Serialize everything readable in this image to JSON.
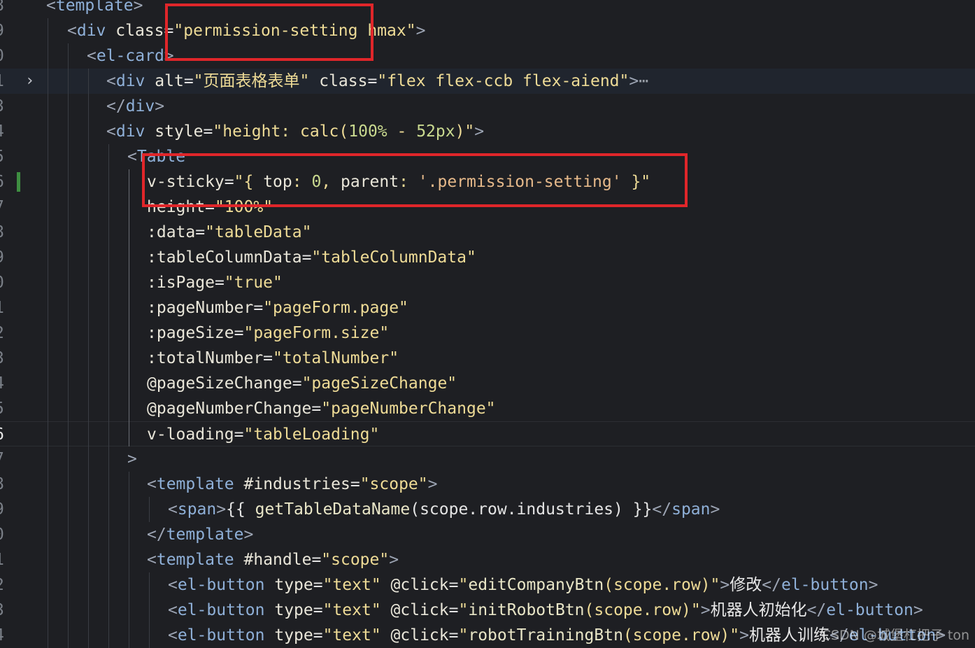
{
  "editor": {
    "watermark": "CSDN @城堡杠把子 ton",
    "lines": [
      {
        "num": "8",
        "tokens": [
          [
            "t-bracket",
            "<"
          ],
          [
            "t-tag",
            "template"
          ],
          [
            "t-bracket",
            ">"
          ]
        ]
      },
      {
        "num": "9",
        "tokens": [
          [
            "t-bracket",
            "<"
          ],
          [
            "t-tag",
            "div"
          ],
          [
            "t-plain",
            " "
          ],
          [
            "t-attr",
            "class"
          ],
          [
            "t-plain",
            "="
          ],
          [
            "t-str",
            "\"permission-setting hmax\""
          ],
          [
            "t-bracket",
            ">"
          ]
        ]
      },
      {
        "num": "0",
        "tokens": [
          [
            "t-bracket",
            "<"
          ],
          [
            "t-tag",
            "el-card"
          ],
          [
            "t-bracket",
            ">"
          ]
        ]
      },
      {
        "num": "1",
        "tokens": [
          [
            "t-bracket",
            "<"
          ],
          [
            "t-tag",
            "div"
          ],
          [
            "t-plain",
            " "
          ],
          [
            "t-attr",
            "alt"
          ],
          [
            "t-plain",
            "="
          ],
          [
            "t-str",
            "\"页面表格表单\""
          ],
          [
            "t-plain",
            " "
          ],
          [
            "t-attr",
            "class"
          ],
          [
            "t-plain",
            "="
          ],
          [
            "t-str",
            "\"flex flex-ccb flex-aiend\""
          ],
          [
            "t-bracket",
            ">"
          ],
          [
            "t-ellipsis",
            "⋯"
          ]
        ]
      },
      {
        "num": "3",
        "tokens": [
          [
            "t-bracket",
            "</"
          ],
          [
            "t-tag",
            "div"
          ],
          [
            "t-bracket",
            ">"
          ]
        ]
      },
      {
        "num": "4",
        "tokens": [
          [
            "t-bracket",
            "<"
          ],
          [
            "t-tag",
            "div"
          ],
          [
            "t-plain",
            " "
          ],
          [
            "t-attr",
            "style"
          ],
          [
            "t-plain",
            "="
          ],
          [
            "t-str",
            "\"height: calc("
          ],
          [
            "t-num",
            "100%"
          ],
          [
            "t-str",
            " - "
          ],
          [
            "t-num",
            "52px"
          ],
          [
            "t-str",
            ")\""
          ],
          [
            "t-bracket",
            ">"
          ]
        ]
      },
      {
        "num": "5",
        "tokens": [
          [
            "t-bracket",
            "<"
          ],
          [
            "t-tag",
            "Table"
          ]
        ]
      },
      {
        "num": "6",
        "tokens": [
          [
            "t-attr",
            "v-sticky"
          ],
          [
            "t-plain",
            "="
          ],
          [
            "t-str",
            "\"{ "
          ],
          [
            "t-attr",
            "top"
          ],
          [
            "t-str",
            ": "
          ],
          [
            "t-num",
            "0"
          ],
          [
            "t-str",
            ", "
          ],
          [
            "t-attr",
            "parent"
          ],
          [
            "t-str",
            ": "
          ],
          [
            "t-str2",
            "'.permission-setting'"
          ],
          [
            "t-str",
            " }\""
          ]
        ]
      },
      {
        "num": "7",
        "tokens": [
          [
            "t-attr",
            "height"
          ],
          [
            "t-plain",
            "="
          ],
          [
            "t-str",
            "\"100%\""
          ]
        ]
      },
      {
        "num": "8",
        "tokens": [
          [
            "t-attr",
            ":data"
          ],
          [
            "t-plain",
            "="
          ],
          [
            "t-str",
            "\"tableData\""
          ]
        ]
      },
      {
        "num": "9",
        "tokens": [
          [
            "t-attr",
            ":tableColumnData"
          ],
          [
            "t-plain",
            "="
          ],
          [
            "t-str",
            "\"tableColumnData\""
          ]
        ]
      },
      {
        "num": "0",
        "tokens": [
          [
            "t-attr",
            ":isPage"
          ],
          [
            "t-plain",
            "="
          ],
          [
            "t-str",
            "\"true\""
          ]
        ]
      },
      {
        "num": "1",
        "tokens": [
          [
            "t-attr",
            ":pageNumber"
          ],
          [
            "t-plain",
            "="
          ],
          [
            "t-str",
            "\"pageForm.page\""
          ]
        ]
      },
      {
        "num": "2",
        "tokens": [
          [
            "t-attr",
            ":pageSize"
          ],
          [
            "t-plain",
            "="
          ],
          [
            "t-str",
            "\"pageForm.size\""
          ]
        ]
      },
      {
        "num": "3",
        "tokens": [
          [
            "t-attr",
            ":totalNumber"
          ],
          [
            "t-plain",
            "="
          ],
          [
            "t-str",
            "\"totalNumber\""
          ]
        ]
      },
      {
        "num": "4",
        "tokens": [
          [
            "t-attr",
            "@pageSizeChange"
          ],
          [
            "t-plain",
            "="
          ],
          [
            "t-str",
            "\"pageSizeChange\""
          ]
        ]
      },
      {
        "num": "5",
        "tokens": [
          [
            "t-attr",
            "@pageNumberChange"
          ],
          [
            "t-plain",
            "="
          ],
          [
            "t-str",
            "\"pageNumberChange\""
          ]
        ]
      },
      {
        "num": "6",
        "tokens": [
          [
            "t-attr",
            "v-loading"
          ],
          [
            "t-plain",
            "="
          ],
          [
            "t-str",
            "\"tableLoading\""
          ]
        ]
      },
      {
        "num": "7",
        "tokens": [
          [
            "t-bracket",
            ">"
          ]
        ]
      },
      {
        "num": "8",
        "tokens": [
          [
            "t-bracket",
            "<"
          ],
          [
            "t-tag",
            "template"
          ],
          [
            "t-plain",
            " "
          ],
          [
            "t-attr",
            "#industries"
          ],
          [
            "t-plain",
            "="
          ],
          [
            "t-str",
            "\"scope\""
          ],
          [
            "t-bracket",
            ">"
          ]
        ]
      },
      {
        "num": "9",
        "tokens": [
          [
            "t-bracket",
            "<"
          ],
          [
            "t-tag",
            "span"
          ],
          [
            "t-bracket",
            ">"
          ],
          [
            "t-plain",
            "{{ "
          ],
          [
            "t-fn",
            "getTableDataName"
          ],
          [
            "t-plain",
            "(scope.row.industries) }}"
          ],
          [
            "t-bracket",
            "</"
          ],
          [
            "t-tag",
            "span"
          ],
          [
            "t-bracket",
            ">"
          ]
        ]
      },
      {
        "num": "0",
        "tokens": [
          [
            "t-bracket",
            "</"
          ],
          [
            "t-tag",
            "template"
          ],
          [
            "t-bracket",
            ">"
          ]
        ]
      },
      {
        "num": "1",
        "tokens": [
          [
            "t-bracket",
            "<"
          ],
          [
            "t-tag",
            "template"
          ],
          [
            "t-plain",
            " "
          ],
          [
            "t-attr",
            "#handle"
          ],
          [
            "t-plain",
            "="
          ],
          [
            "t-str",
            "\"scope\""
          ],
          [
            "t-bracket",
            ">"
          ]
        ]
      },
      {
        "num": "2",
        "tokens": [
          [
            "t-bracket",
            "<"
          ],
          [
            "t-tag",
            "el-button"
          ],
          [
            "t-plain",
            " "
          ],
          [
            "t-attr",
            "type"
          ],
          [
            "t-plain",
            "="
          ],
          [
            "t-str",
            "\"text\""
          ],
          [
            "t-plain",
            " "
          ],
          [
            "t-attr",
            "@click"
          ],
          [
            "t-plain",
            "="
          ],
          [
            "t-str",
            "\""
          ],
          [
            "t-fn",
            "editCompanyBtn"
          ],
          [
            "t-str",
            "(scope.row)\""
          ],
          [
            "t-bracket",
            ">"
          ],
          [
            "t-cjk",
            "修改"
          ],
          [
            "t-bracket",
            "</"
          ],
          [
            "t-tag",
            "el-button"
          ],
          [
            "t-bracket",
            ">"
          ]
        ]
      },
      {
        "num": "3",
        "tokens": [
          [
            "t-bracket",
            "<"
          ],
          [
            "t-tag",
            "el-button"
          ],
          [
            "t-plain",
            " "
          ],
          [
            "t-attr",
            "type"
          ],
          [
            "t-plain",
            "="
          ],
          [
            "t-str",
            "\"text\""
          ],
          [
            "t-plain",
            " "
          ],
          [
            "t-attr",
            "@click"
          ],
          [
            "t-plain",
            "="
          ],
          [
            "t-str",
            "\""
          ],
          [
            "t-fn",
            "initRobotBtn"
          ],
          [
            "t-str",
            "(scope.row)\""
          ],
          [
            "t-bracket",
            ">"
          ],
          [
            "t-cjk",
            "机器人初始化"
          ],
          [
            "t-bracket",
            "</"
          ],
          [
            "t-tag",
            "el-button"
          ],
          [
            "t-bracket",
            ">"
          ]
        ]
      },
      {
        "num": "4",
        "tokens": [
          [
            "t-bracket",
            "<"
          ],
          [
            "t-tag",
            "el-button"
          ],
          [
            "t-plain",
            " "
          ],
          [
            "t-attr",
            "type"
          ],
          [
            "t-plain",
            "="
          ],
          [
            "t-str",
            "\"text\""
          ],
          [
            "t-plain",
            " "
          ],
          [
            "t-attr",
            "@click"
          ],
          [
            "t-plain",
            "="
          ],
          [
            "t-str",
            "\""
          ],
          [
            "t-fn",
            "robotTrainingBtn"
          ],
          [
            "t-str",
            "(scope.row)\""
          ],
          [
            "t-bracket",
            ">"
          ],
          [
            "t-cjk",
            "机器人训练"
          ],
          [
            "t-bracket",
            "</"
          ],
          [
            "t-tag",
            "el-button"
          ],
          [
            "t-bracket",
            ">"
          ]
        ]
      }
    ]
  }
}
